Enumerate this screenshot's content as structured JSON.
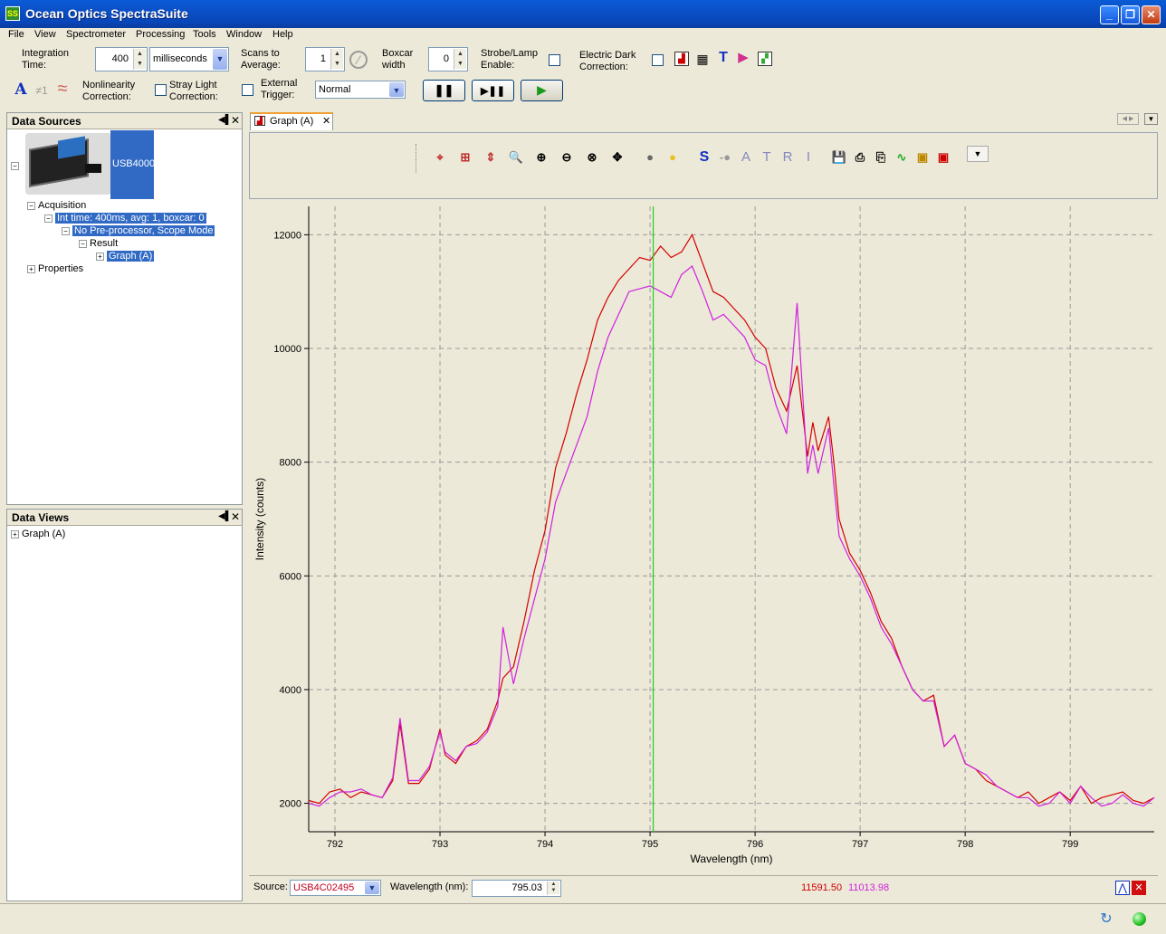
{
  "window": {
    "title": "Ocean Optics SpectraSuite",
    "app_icon": "SS"
  },
  "menu": [
    "File",
    "View",
    "Spectrometer",
    "Processing",
    "Tools",
    "Window",
    "Help"
  ],
  "toolbar": {
    "integration_label": "Integration\nTime:",
    "integration_value": "400",
    "integration_unit": "milliseconds",
    "scans_label": "Scans to\nAverage:",
    "scans_value": "1",
    "boxcar_label": "Boxcar\nwidth",
    "boxcar_value": "0",
    "strobe_label": "Strobe/Lamp\nEnable:",
    "dark_label": "Electric Dark\nCorrection:",
    "nonlinearity_label": "Nonlinearity\nCorrection:",
    "stray_label": "Stray Light\nCorrection:",
    "trigger_label": "External\nTrigger:",
    "trigger_value": "Normal",
    "a_glyph": "A",
    "neq_glyph": "≠1",
    "wave_glyph": "≈"
  },
  "data_sources": {
    "title": "Data Sources",
    "device": "USB4000",
    "acquisition": "Acquisition",
    "int_time": "Int time: 400ms, avg: 1, boxcar: 0",
    "preprocessor": "No Pre-processor, Scope Mode",
    "result": "Result",
    "graph": "Graph (A)",
    "properties": "Properties"
  },
  "data_views": {
    "title": "Data Views",
    "graph": "Graph (A)"
  },
  "graph_tab": {
    "label": "Graph (A)"
  },
  "chart_toolbar_letters": [
    "S",
    "A",
    "T",
    "R",
    "I"
  ],
  "status": {
    "source_label": "Source:",
    "source_value": "USB4C02495",
    "wavelength_label": "Wavelength (nm):",
    "wavelength_value": "795.03",
    "readout_red": "11591.50",
    "readout_magenta": "11013.98"
  },
  "colors": {
    "series_red": "#d40000",
    "series_magenta": "#d020e0",
    "cursor": "#20d020",
    "selection": "#316ac5"
  },
  "chart_data": {
    "type": "line",
    "xlabel": "Wavelength (nm)",
    "ylabel": "Intensity (counts)",
    "xlim": [
      791.75,
      799.8
    ],
    "ylim": [
      1500,
      12500
    ],
    "xticks": [
      792,
      793,
      794,
      795,
      796,
      797,
      798,
      799
    ],
    "yticks": [
      2000,
      4000,
      6000,
      8000,
      10000,
      12000
    ],
    "grid": true,
    "cursor_x": 795.03,
    "series": [
      {
        "color": "#d40000",
        "x": [
          791.75,
          791.85,
          791.95,
          792.05,
          792.15,
          792.25,
          792.35,
          792.45,
          792.55,
          792.62,
          792.7,
          792.8,
          792.9,
          793.0,
          793.05,
          793.15,
          793.25,
          793.35,
          793.45,
          793.55,
          793.6,
          793.7,
          793.8,
          793.9,
          794.0,
          794.1,
          794.2,
          794.3,
          794.4,
          794.5,
          794.6,
          794.7,
          794.8,
          794.9,
          795.0,
          795.1,
          795.2,
          795.3,
          795.4,
          795.5,
          795.6,
          795.7,
          795.8,
          795.9,
          796.0,
          796.1,
          796.2,
          796.3,
          796.4,
          796.5,
          796.55,
          796.6,
          796.7,
          796.75,
          796.8,
          796.9,
          797.0,
          797.1,
          797.2,
          797.3,
          797.4,
          797.5,
          797.6,
          797.7,
          797.8,
          797.9,
          798.0,
          798.1,
          798.2,
          798.3,
          798.4,
          798.5,
          798.6,
          798.7,
          798.8,
          798.9,
          799.0,
          799.1,
          799.2,
          799.3,
          799.4,
          799.5,
          799.6,
          799.7,
          799.8
        ],
        "y": [
          2050,
          2000,
          2200,
          2250,
          2100,
          2200,
          2150,
          2100,
          2400,
          3400,
          2350,
          2350,
          2600,
          3300,
          2850,
          2700,
          3000,
          3100,
          3300,
          3800,
          4200,
          4400,
          5200,
          6100,
          6800,
          7900,
          8500,
          9200,
          9800,
          10500,
          10900,
          11200,
          11400,
          11600,
          11550,
          11800,
          11600,
          11700,
          12000,
          11500,
          11000,
          10900,
          10700,
          10500,
          10200,
          10000,
          9300,
          8900,
          9700,
          8100,
          8700,
          8200,
          8800,
          8000,
          7000,
          6400,
          6100,
          5700,
          5200,
          4900,
          4400,
          4000,
          3800,
          3900,
          3000,
          3200,
          2700,
          2600,
          2400,
          2300,
          2200,
          2100,
          2200,
          2000,
          2100,
          2200,
          2050,
          2300,
          2000,
          2100,
          2150,
          2200,
          2050,
          2000,
          2100
        ]
      },
      {
        "color": "#d020e0",
        "x": [
          791.75,
          791.85,
          791.95,
          792.05,
          792.15,
          792.25,
          792.35,
          792.45,
          792.55,
          792.62,
          792.7,
          792.8,
          792.9,
          793.0,
          793.05,
          793.15,
          793.25,
          793.35,
          793.45,
          793.55,
          793.6,
          793.7,
          793.8,
          793.9,
          794.0,
          794.1,
          794.2,
          794.3,
          794.4,
          794.5,
          794.6,
          794.7,
          794.8,
          794.9,
          795.0,
          795.1,
          795.2,
          795.3,
          795.4,
          795.5,
          795.6,
          795.7,
          795.8,
          795.9,
          796.0,
          796.1,
          796.2,
          796.3,
          796.4,
          796.5,
          796.55,
          796.6,
          796.7,
          796.75,
          796.8,
          796.9,
          797.0,
          797.1,
          797.2,
          797.3,
          797.4,
          797.5,
          797.6,
          797.7,
          797.8,
          797.9,
          798.0,
          798.1,
          798.2,
          798.3,
          798.4,
          798.5,
          798.6,
          798.7,
          798.8,
          798.9,
          799.0,
          799.1,
          799.2,
          799.3,
          799.4,
          799.5,
          799.6,
          799.7,
          799.8
        ],
        "y": [
          2000,
          1950,
          2100,
          2200,
          2200,
          2250,
          2150,
          2100,
          2450,
          3500,
          2400,
          2400,
          2650,
          3250,
          2900,
          2750,
          3000,
          3050,
          3250,
          3700,
          5100,
          4100,
          4900,
          5600,
          6300,
          7300,
          7800,
          8300,
          8800,
          9600,
          10200,
          10600,
          11000,
          11050,
          11100,
          11000,
          10900,
          11300,
          11450,
          11000,
          10500,
          10600,
          10400,
          10200,
          9800,
          9700,
          9000,
          8500,
          10800,
          7800,
          8300,
          7800,
          8600,
          7600,
          6700,
          6300,
          6000,
          5600,
          5100,
          4800,
          4400,
          4000,
          3800,
          3800,
          3000,
          3200,
          2700,
          2600,
          2500,
          2300,
          2200,
          2100,
          2100,
          1950,
          2000,
          2200,
          2000,
          2300,
          2100,
          1950,
          2000,
          2150,
          2000,
          1950,
          2100
        ]
      }
    ]
  }
}
